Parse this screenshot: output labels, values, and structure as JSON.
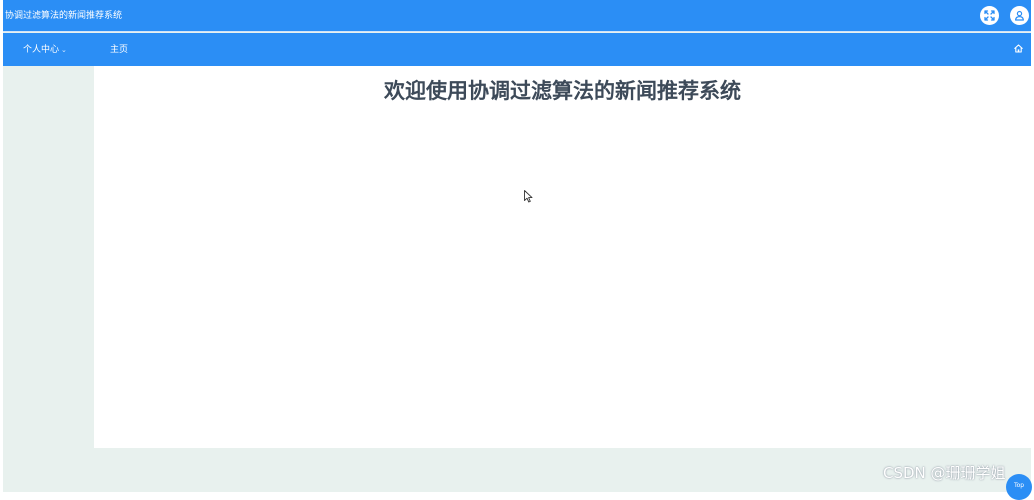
{
  "app": {
    "title": "协调过滤算法的新闻推荐系统"
  },
  "header": {
    "fullscreen_icon": "fullscreen-icon",
    "user_icon": "user-icon"
  },
  "nav": {
    "personal_center_label": "个人中心",
    "personal_center_arrow": "⌄",
    "home_label": "主页",
    "home_icon": "home-icon"
  },
  "main": {
    "welcome_text": "欢迎使用协调过滤算法的新闻推荐系统"
  },
  "footer": {
    "watermark": "CSDN @珊珊学姐",
    "top_button_label": "Top"
  },
  "colors": {
    "primary": "#2b8ef5",
    "sidebar_bg": "#e8f1ee",
    "heading": "#3d4a59"
  }
}
